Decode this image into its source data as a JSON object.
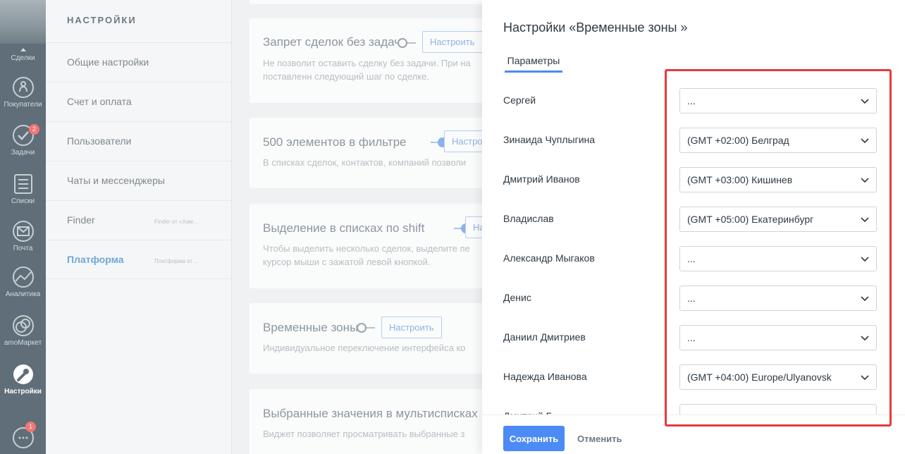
{
  "rail": {
    "items": [
      {
        "label": "Сделки"
      },
      {
        "label": "Покупатели"
      },
      {
        "label": "Задачи",
        "badge": "2"
      },
      {
        "label": "Списки"
      },
      {
        "label": "Почта"
      },
      {
        "label": "Аналитика"
      },
      {
        "label": "amoМаркет"
      },
      {
        "label": "Настройки"
      },
      {
        "label": "",
        "badge": "1"
      }
    ]
  },
  "settings_nav": {
    "title": "НАСТРОЙКИ",
    "items": [
      {
        "label": "Общие настройки",
        "sub": ""
      },
      {
        "label": "Счет и оплата",
        "sub": ""
      },
      {
        "label": "Пользователи",
        "sub": ""
      },
      {
        "label": "Чаты и мессенджеры",
        "sub": ""
      },
      {
        "label": "Finder",
        "sub": "Finder от «Хам..."
      },
      {
        "label": "Платформа",
        "sub": "Платформа от ..."
      }
    ]
  },
  "content": {
    "cards": [
      {
        "title": "Запрет сделок без задач",
        "desc1": "Не позволит оставить сделку без задачи. При на",
        "desc2": "поставленн следующий шаг по сделке.",
        "button": "Настроить"
      },
      {
        "title": "500 элементов в фильтре",
        "desc1": "В списках сделок, контактов, компаний позволи",
        "desc2": "",
        "button": "Настроить"
      },
      {
        "title": "Выделение в списках по shift",
        "desc1": "Чтобы выделить несколько сделок, выделите пе",
        "desc2": "курсор мыши с зажатой левой кнопкой.",
        "button": "Настроить"
      },
      {
        "title": "Временные зоны",
        "desc1": "Индивидуальное переключение интерфейса ко",
        "desc2": "",
        "button": "Настроить"
      },
      {
        "title": "Выбранные значения в мультисписках",
        "desc1": "Виджет позволяет просматривать выбранные з",
        "desc2": "",
        "button": ""
      }
    ]
  },
  "modal": {
    "title": "Настройки «Временные зоны »",
    "tab": "Параметры",
    "users": [
      {
        "name": "Сергей",
        "tz": "..."
      },
      {
        "name": "Зинаида Чуплыгина",
        "tz": "(GMT +02:00) Белград"
      },
      {
        "name": "Дмитрий Иванов",
        "tz": "(GMT +03:00) Кишинев"
      },
      {
        "name": "Владислав",
        "tz": "(GMT +05:00) Екатеринбург"
      },
      {
        "name": "Александр Мыгаков",
        "tz": "..."
      },
      {
        "name": "Денис",
        "tz": "..."
      },
      {
        "name": "Даниил Дмитриев",
        "tz": "..."
      },
      {
        "name": "Надежда Иванова",
        "tz": "(GMT +04:00) Europe/Ulyanovsk"
      },
      {
        "name": "Дмитрий Б...",
        "tz": ""
      }
    ],
    "save": "Сохранить",
    "cancel": "Отменить"
  },
  "colors": {
    "accent": "#4c8bf5",
    "highlight": "#e43b3b"
  }
}
